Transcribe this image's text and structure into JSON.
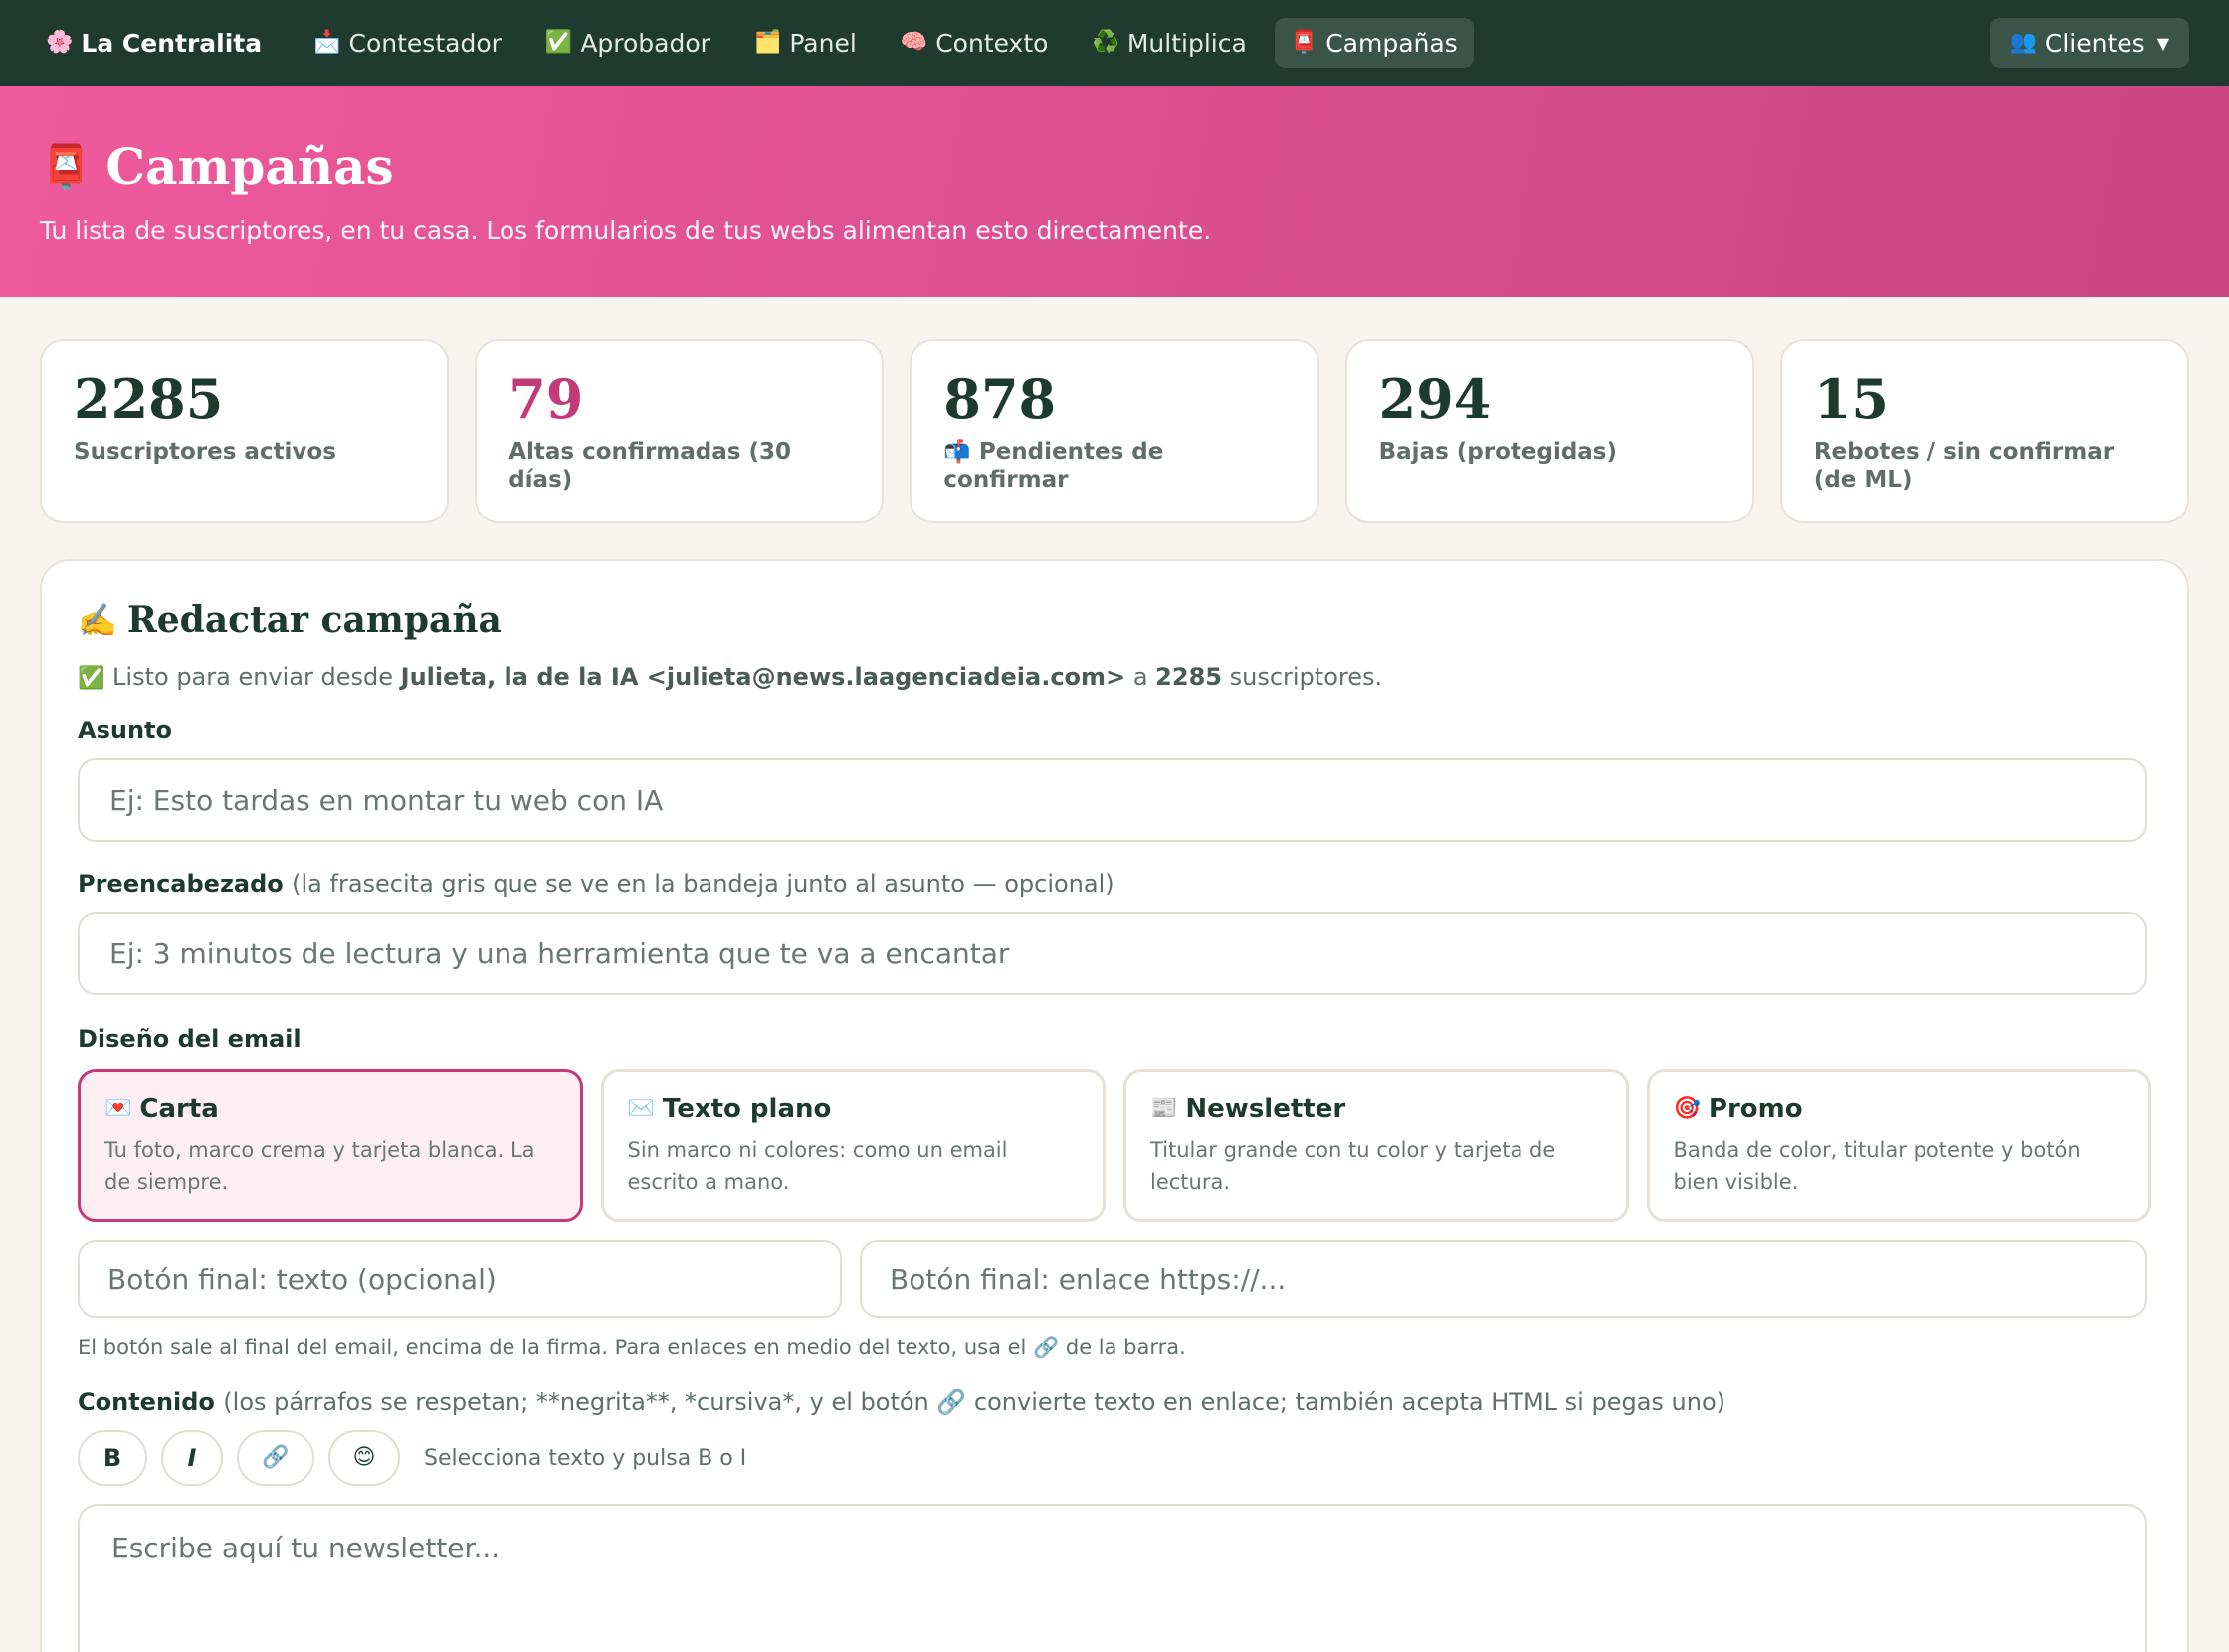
{
  "nav": {
    "brand": "La Centralita",
    "items": [
      {
        "label": "Contestador",
        "icon": "📩"
      },
      {
        "label": "Aprobador",
        "icon": "✅"
      },
      {
        "label": "Panel",
        "icon": "🗂️"
      },
      {
        "label": "Contexto",
        "icon": "🧠"
      },
      {
        "label": "Multiplica",
        "icon": "♻️"
      },
      {
        "label": "Campañas",
        "icon": "📮"
      }
    ],
    "active": "Campañas",
    "clients": "Clientes",
    "brand_icon": "🌸",
    "clients_icon": "👥"
  },
  "hero": {
    "icon": "📮",
    "title": "Campañas",
    "subtitle": "Tu lista de suscriptores, en tu casa. Los formularios de tus webs alimentan esto directamente."
  },
  "stats": [
    {
      "value": "2285",
      "label": "Suscriptores activos"
    },
    {
      "value": "79",
      "label": "Altas confirmadas (30 días)"
    },
    {
      "value": "878",
      "label": "Pendientes de confirmar",
      "icon": "📬"
    },
    {
      "value": "294",
      "label": "Bajas (protegidas)"
    },
    {
      "value": "15",
      "label": "Rebotes / sin confirmar (de ML)"
    }
  ],
  "compose": {
    "icon": "✍️",
    "title": "Redactar campaña",
    "ready_icon": "✅",
    "ready_prefix": "Listo para enviar desde",
    "sender": "Julieta, la de la IA <julieta@news.laagenciadeia.com>",
    "ready_mid": "a",
    "count": "2285",
    "ready_suffix": "suscriptores.",
    "subject_label": "Asunto",
    "subject_placeholder": "Ej: Esto tardas en montar tu web con IA",
    "preheader_label": "Preencabezado",
    "preheader_hint": "(la frasecita gris que se ve en la bandeja junto al asunto — opcional)",
    "preheader_placeholder": "Ej: 3 minutos de lectura y una herramienta que te va a encantar",
    "design_label": "Diseño del email",
    "designs": [
      {
        "icon": "💌",
        "name": "Carta",
        "desc": "Tu foto, marco crema y tarjeta blanca. La de siempre."
      },
      {
        "icon": "✉️",
        "name": "Texto plano",
        "desc": "Sin marco ni colores: como un email escrito a mano."
      },
      {
        "icon": "📰",
        "name": "Newsletter",
        "desc": "Titular grande con tu color y tarjeta de lectura."
      },
      {
        "icon": "🎯",
        "name": "Promo",
        "desc": "Banda de color, titular potente y botón bien visible."
      }
    ],
    "selected_design": "Carta",
    "button_text_placeholder": "Botón final: texto (opcional)",
    "button_link_placeholder": "Botón final: enlace https://...",
    "button_help": "El botón sale al final del email, encima de la firma. Para enlaces en medio del texto, usa el 🔗 de la barra.",
    "content_label": "Contenido",
    "content_hint": "(los párrafos se respetan; **negrita**, *cursiva*, y el botón 🔗 convierte texto en enlace; también acepta HTML si pegas uno)",
    "toolbar": {
      "bold": "B",
      "italic": "I",
      "link": "🔗",
      "emoji": "😊",
      "hint": "Selecciona texto y pulsa B o I"
    },
    "content_placeholder": "Escribe aquí tu newsletter..."
  },
  "colors": {
    "nav_bg": "#1f3b2f",
    "accent_pink": "#c23a78",
    "hero_pink": "#e4559a",
    "text_dark": "#1d3a2e"
  }
}
